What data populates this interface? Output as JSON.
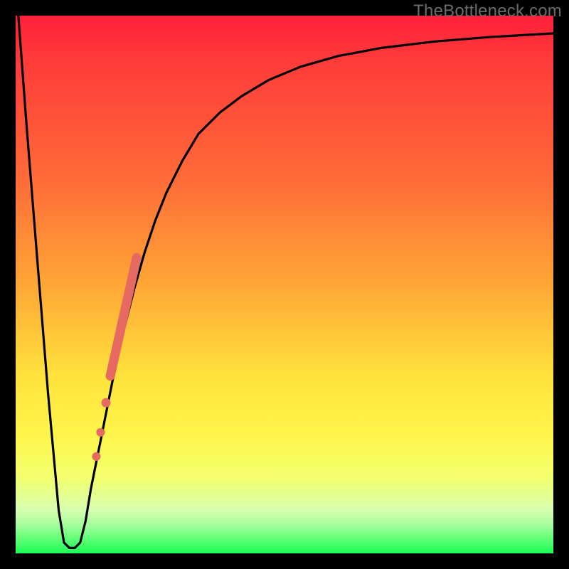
{
  "watermark": "TheBottleneck.com",
  "chart_data": {
    "type": "line",
    "title": "",
    "xlabel": "",
    "ylabel": "",
    "xlim": [
      0,
      100
    ],
    "ylim": [
      0,
      100
    ],
    "grid": false,
    "background_gradient": [
      "#ff1f3a",
      "#ff6a38",
      "#ffe23c",
      "#1bfd55"
    ],
    "series": [
      {
        "name": "bottleneck-curve",
        "color": "#000000",
        "x": [
          0.5,
          2,
          4,
          6,
          8,
          9,
          10,
          11,
          12,
          13,
          14,
          16,
          18,
          20,
          22,
          24,
          26,
          28,
          31,
          34,
          38,
          42,
          47,
          53,
          60,
          68,
          78,
          88,
          100
        ],
        "y": [
          100,
          80,
          55,
          30,
          8,
          2,
          1,
          1,
          2,
          6,
          12,
          22,
          32,
          41,
          49,
          56,
          62,
          67,
          73,
          78,
          82,
          85,
          88,
          90.5,
          92.5,
          94,
          95.2,
          96,
          96.7
        ]
      }
    ],
    "highlight_segment": {
      "name": "observed-range",
      "color": "#e66a62",
      "x": [
        15.0,
        15.8,
        16.8,
        17.6,
        22.5
      ],
      "y": [
        18.0,
        22.5,
        28.0,
        33.0,
        55.0
      ],
      "style": "thick-with-dots"
    }
  }
}
